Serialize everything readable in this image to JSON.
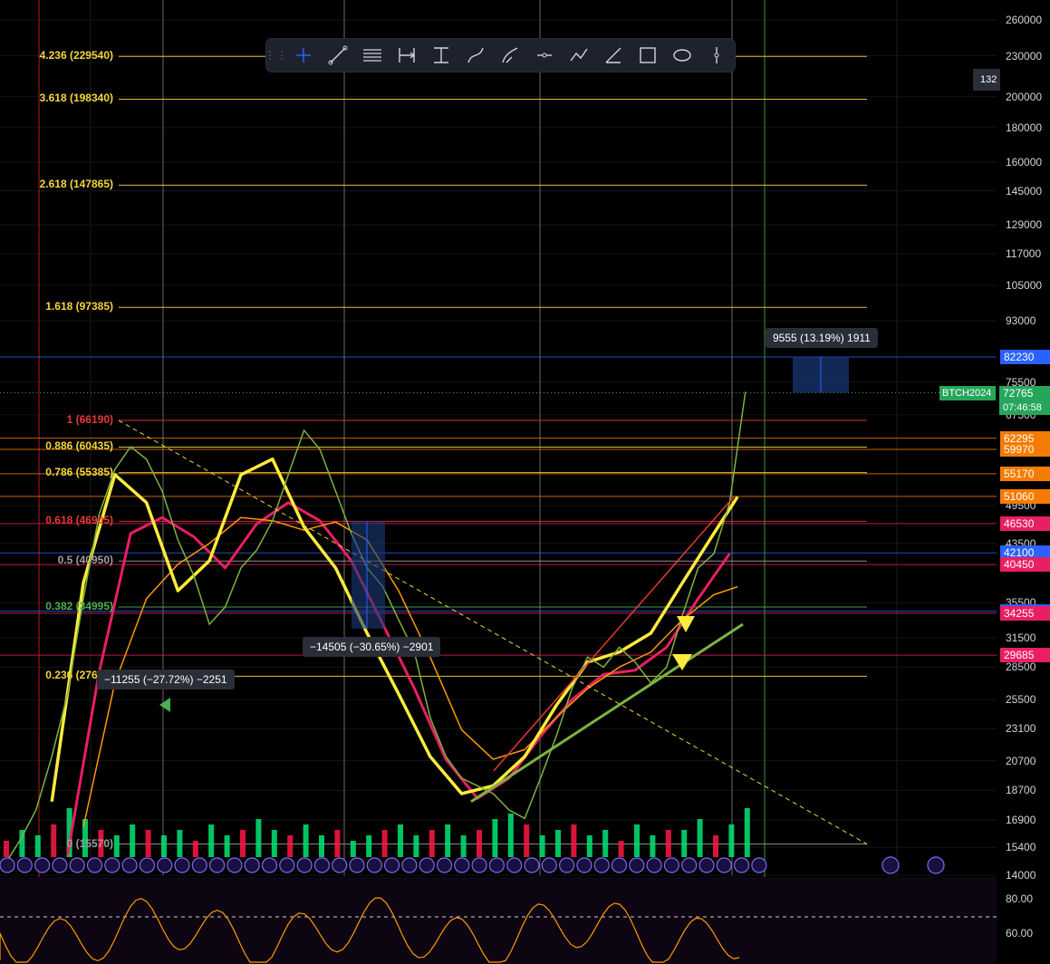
{
  "toolbar": {
    "tools": [
      "crosshair-icon",
      "trend-line-icon",
      "horizontal-lines-icon",
      "date-range-icon",
      "price-range-icon",
      "curve-icon",
      "brush-icon",
      "horizontal-ray-icon",
      "polyline-icon",
      "angle-icon",
      "rectangle-icon",
      "ellipse-icon",
      "vertical-line-icon"
    ]
  },
  "axis": {
    "ticks": [
      {
        "label": "260000",
        "v": 260000
      },
      {
        "label": "230000",
        "v": 230000
      },
      {
        "label": "200000",
        "v": 200000
      },
      {
        "label": "180000",
        "v": 180000
      },
      {
        "label": "160000",
        "v": 160000
      },
      {
        "label": "145000",
        "v": 145000
      },
      {
        "label": "129000",
        "v": 129000
      },
      {
        "label": "117000",
        "v": 117000
      },
      {
        "label": "105000",
        "v": 105000
      },
      {
        "label": "93000",
        "v": 93000
      },
      {
        "label": "75500",
        "v": 75500
      },
      {
        "label": "67500",
        "v": 67500
      },
      {
        "label": "49500",
        "v": 49500
      },
      {
        "label": "43500",
        "v": 43500
      },
      {
        "label": "35500",
        "v": 35500
      },
      {
        "label": "31500",
        "v": 31500
      },
      {
        "label": "28500",
        "v": 28500
      },
      {
        "label": "25500",
        "v": 25500
      },
      {
        "label": "23100",
        "v": 23100
      },
      {
        "label": "20700",
        "v": 20700
      },
      {
        "label": "18700",
        "v": 18700
      },
      {
        "label": "16900",
        "v": 16900
      },
      {
        "label": "15400",
        "v": 15400
      },
      {
        "label": "14000",
        "v": 14000
      }
    ],
    "partial_label": "132"
  },
  "price_labels": [
    {
      "text": "82230",
      "v": 82230,
      "color": "#2962ff"
    },
    {
      "text": "62295",
      "v": 62295,
      "color": "#f57c00"
    },
    {
      "text": "59970",
      "v": 59970,
      "color": "#f57c00"
    },
    {
      "text": "55170",
      "v": 55170,
      "color": "#f57c00"
    },
    {
      "text": "51060",
      "v": 51060,
      "color": "#f57c00"
    },
    {
      "text": "46530",
      "v": 46530,
      "color": "#e91e63"
    },
    {
      "text": "42100",
      "v": 42100,
      "color": "#2962ff"
    },
    {
      "text": "40450",
      "v": 40450,
      "color": "#e91e63"
    },
    {
      "text": "34495",
      "v": 34495,
      "color": "#2962ff"
    },
    {
      "text": "34255",
      "v": 34255,
      "color": "#e91e63"
    },
    {
      "text": "29685",
      "v": 29685,
      "color": "#e91e63"
    }
  ],
  "symbol": {
    "name": "BTCH2024",
    "price": "72765",
    "countdown": "07:46:58",
    "color": "#26a65b"
  },
  "fib_levels": [
    {
      "label": "4.236 (229540)",
      "v": 229540,
      "color": "#f2d53c"
    },
    {
      "label": "3.618 (198340)",
      "v": 198340,
      "color": "#f2d53c"
    },
    {
      "label": "2.618 (147865)",
      "v": 147865,
      "color": "#f2d53c"
    },
    {
      "label": "1.618 (97385)",
      "v": 97385,
      "color": "#f2d53c"
    },
    {
      "label": "1 (66190)",
      "v": 66190,
      "color": "#e53935"
    },
    {
      "label": "0.886 (60435)",
      "v": 60435,
      "color": "#f2d53c"
    },
    {
      "label": "0.786 (55385)",
      "v": 55385,
      "color": "#f2d53c"
    },
    {
      "label": "0.618 (46905)",
      "v": 46905,
      "color": "#e53935"
    },
    {
      "label": "0.5 (40950)",
      "v": 40950,
      "color": "#9e9e9e"
    },
    {
      "label": "0.382 (34995)",
      "v": 34995,
      "color": "#4caf50"
    },
    {
      "label": "0.236 (27625)",
      "v": 27625,
      "color": "#f2d53c"
    },
    {
      "label": "0 (15570)",
      "v": 15570,
      "color": "#9e9e9e"
    }
  ],
  "measurements": [
    {
      "text": "9555 (13.19%) 1911"
    },
    {
      "text": "−14505 (−30.65%) −2901"
    },
    {
      "text": "−11255 (−27.72%) −2251"
    }
  ],
  "oscillator": {
    "ticks": [
      {
        "label": "80.00",
        "v": 80
      },
      {
        "label": "60.00",
        "v": 60
      }
    ]
  },
  "chart_data": {
    "type": "line",
    "log_scale": true,
    "ylim": [
      14000,
      270000
    ],
    "price_path": [
      [
        0,
        14500
      ],
      [
        2,
        15800
      ],
      [
        4,
        17500
      ],
      [
        6,
        21000
      ],
      [
        8,
        26000
      ],
      [
        10,
        36000
      ],
      [
        12,
        48000
      ],
      [
        14,
        56000
      ],
      [
        16,
        60500
      ],
      [
        18,
        58000
      ],
      [
        20,
        52000
      ],
      [
        22,
        44000
      ],
      [
        24,
        39000
      ],
      [
        26,
        33000
      ],
      [
        28,
        35000
      ],
      [
        30,
        40000
      ],
      [
        32,
        42500
      ],
      [
        34,
        47000
      ],
      [
        36,
        55000
      ],
      [
        38,
        64000
      ],
      [
        40,
        60000
      ],
      [
        42,
        52000
      ],
      [
        44,
        45000
      ],
      [
        46,
        40000
      ],
      [
        48,
        37500
      ],
      [
        50,
        33500
      ],
      [
        52,
        30000
      ],
      [
        54,
        24000
      ],
      [
        56,
        21000
      ],
      [
        58,
        19500
      ],
      [
        60,
        19000
      ],
      [
        62,
        18500
      ],
      [
        64,
        17500
      ],
      [
        66,
        17000
      ],
      [
        68,
        19500
      ],
      [
        70,
        22500
      ],
      [
        72,
        26500
      ],
      [
        74,
        29500
      ],
      [
        76,
        28500
      ],
      [
        78,
        30500
      ],
      [
        80,
        29000
      ],
      [
        82,
        27000
      ],
      [
        84,
        28500
      ],
      [
        86,
        34000
      ],
      [
        88,
        40000
      ],
      [
        90,
        42000
      ],
      [
        92,
        50000
      ],
      [
        94,
        73000
      ]
    ],
    "series": [
      {
        "values": [
          [
            8,
            15000
          ],
          [
            12,
            28000
          ],
          [
            16,
            45000
          ],
          [
            20,
            47500
          ],
          [
            24,
            44500
          ],
          [
            28,
            40000
          ],
          [
            32,
            46500
          ],
          [
            36,
            50000
          ],
          [
            40,
            47000
          ],
          [
            44,
            41000
          ],
          [
            48,
            33000
          ],
          [
            52,
            26500
          ],
          [
            56,
            20800
          ],
          [
            60,
            18200
          ],
          [
            64,
            19500
          ],
          [
            68,
            22500
          ],
          [
            72,
            25500
          ],
          [
            76,
            27800
          ],
          [
            80,
            28200
          ],
          [
            84,
            30500
          ],
          [
            88,
            36000
          ],
          [
            92,
            42000
          ]
        ]
      },
      {
        "values": [
          [
            10,
            16500
          ],
          [
            14,
            27000
          ],
          [
            18,
            36000
          ],
          [
            22,
            40500
          ],
          [
            26,
            43500
          ],
          [
            30,
            47500
          ],
          [
            34,
            47000
          ],
          [
            38,
            45500
          ],
          [
            42,
            46800
          ],
          [
            46,
            44000
          ],
          [
            50,
            37000
          ],
          [
            54,
            29500
          ],
          [
            58,
            23000
          ],
          [
            62,
            20800
          ],
          [
            66,
            21500
          ],
          [
            70,
            24000
          ],
          [
            74,
            26500
          ],
          [
            78,
            28500
          ],
          [
            82,
            30000
          ],
          [
            86,
            33500
          ],
          [
            90,
            36500
          ],
          [
            93,
            37500
          ]
        ]
      },
      {
        "values": [
          [
            6,
            18000
          ],
          [
            10,
            38000
          ],
          [
            14,
            55000
          ],
          [
            18,
            50000
          ],
          [
            22,
            37000
          ],
          [
            26,
            41000
          ],
          [
            30,
            55000
          ],
          [
            34,
            58000
          ],
          [
            38,
            46000
          ],
          [
            42,
            40000
          ],
          [
            46,
            32000
          ],
          [
            50,
            26000
          ],
          [
            54,
            21000
          ],
          [
            58,
            18500
          ],
          [
            62,
            19000
          ],
          [
            66,
            21000
          ],
          [
            70,
            25000
          ],
          [
            74,
            29000
          ],
          [
            78,
            30000
          ],
          [
            82,
            32000
          ],
          [
            86,
            38000
          ],
          [
            90,
            45000
          ],
          [
            93,
            51000
          ]
        ]
      }
    ],
    "volume": [
      0.3,
      0.5,
      0.4,
      0.6,
      0.9,
      0.7,
      0.5,
      0.4,
      0.6,
      0.5,
      0.4,
      0.5,
      0.3,
      0.6,
      0.4,
      0.5,
      0.7,
      0.5,
      0.4,
      0.6,
      0.4,
      0.5,
      0.3,
      0.4,
      0.5,
      0.6,
      0.4,
      0.5,
      0.6,
      0.4,
      0.5,
      0.7,
      0.8,
      0.6,
      0.4,
      0.5,
      0.6,
      0.4,
      0.5,
      0.3,
      0.6,
      0.4,
      0.5,
      0.5,
      0.7,
      0.4,
      0.6,
      0.9
    ]
  }
}
